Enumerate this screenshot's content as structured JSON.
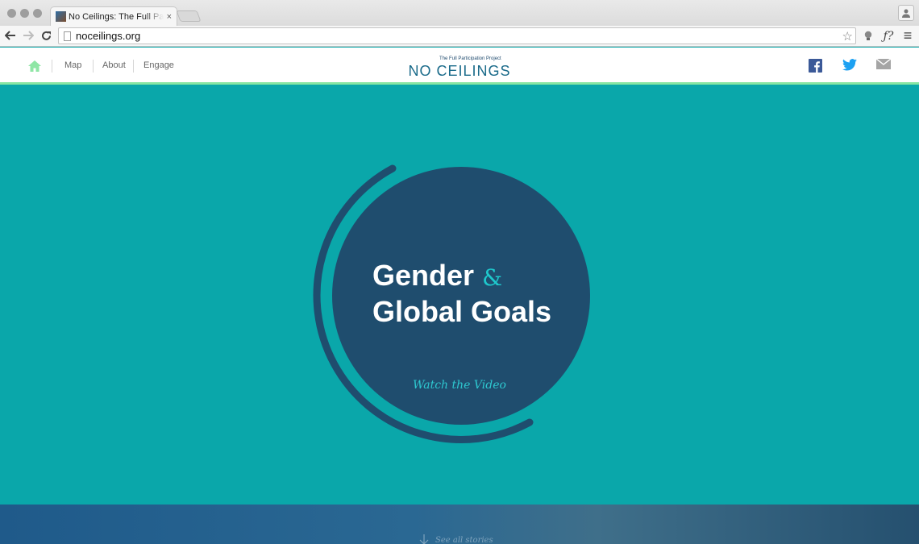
{
  "browser": {
    "tab_title": "No Ceilings: The Full Participation Project",
    "tab_close": "×",
    "url": "noceilings.org",
    "bookmark_star": "☆",
    "ext_font_label": "ƒ?",
    "menu_glyph": "≡"
  },
  "header": {
    "logo_tagline": "The Full Participation Project",
    "logo_name": "NO CEILINGS",
    "nav": [
      {
        "label": "Map"
      },
      {
        "label": "About"
      },
      {
        "label": "Engage"
      }
    ],
    "colors": {
      "accent_green": "#87e6a3",
      "facebook": "#3b5998",
      "twitter": "#1da1f2",
      "mail": "#9a9a9a"
    }
  },
  "hero": {
    "title_line1": "Gender",
    "ampersand": "&",
    "title_line2": "Global Goals",
    "cta": "Watch the Video",
    "colors": {
      "background": "#0aa7aa",
      "circle": "#1f4d6e"
    }
  },
  "stories": {
    "label": "See all stories"
  }
}
